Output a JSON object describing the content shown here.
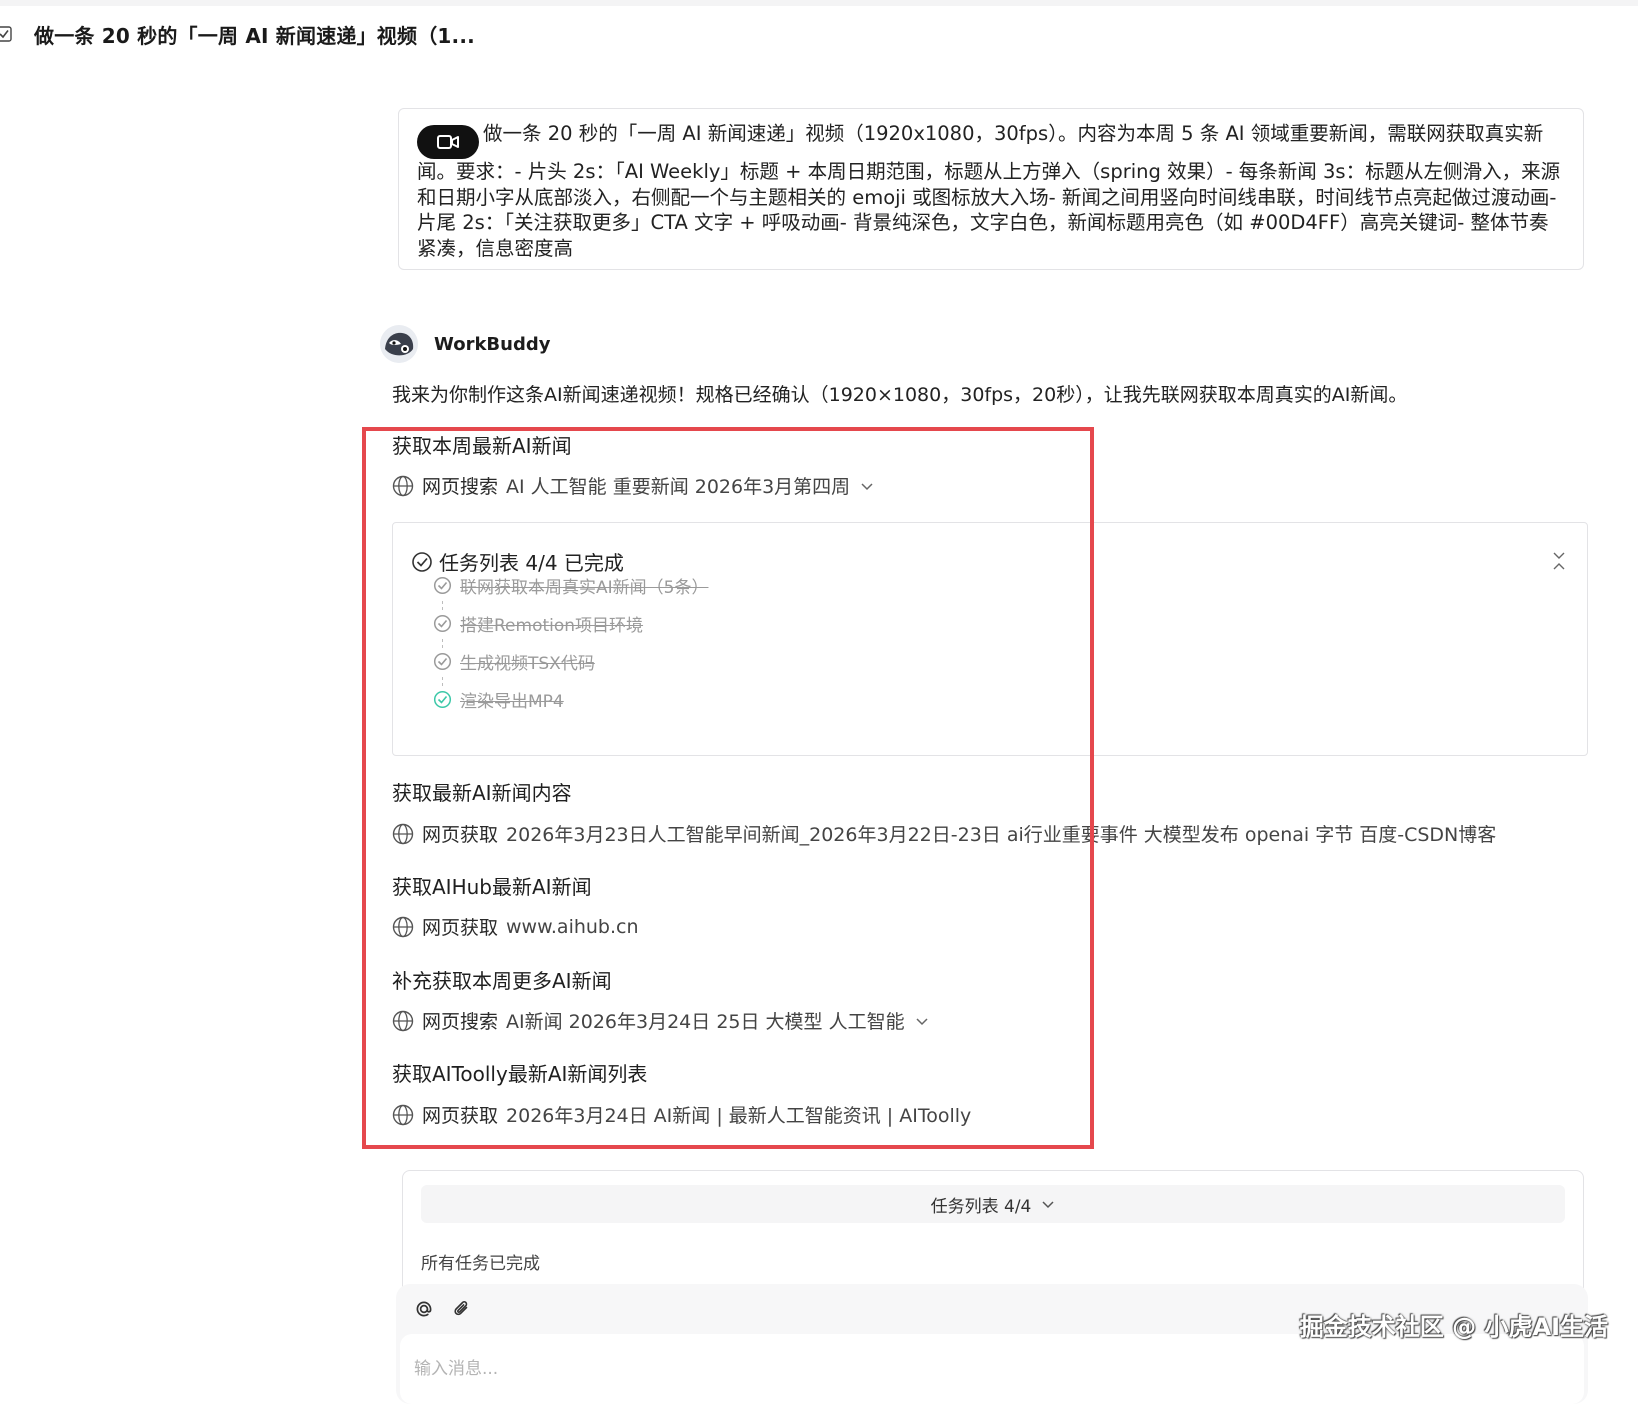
{
  "header": {
    "title": "做一条 20 秒的「一周 AI 新闻速递」视频（1..."
  },
  "prompt": {
    "text": "做一条 20 秒的「一周 AI 新闻速递」视频（1920x1080，30fps）。内容为本周 5 条 AI 领域重要新闻，需联网获取真实新闻。要求：- 片头 2s：「AI Weekly」标题 + 本周日期范围，标题从上方弹入（spring 效果）- 每条新闻 3s：标题从左侧滑入，来源和日期小字从底部淡入，右侧配一个与主题相关的 emoji 或图标放大入场- 新闻之间用竖向时间线串联，时间线节点亮起做过渡动画- 片尾 2s：「关注获取更多」CTA 文字 + 呼吸动画- 背景纯深色，文字白色，新闻标题用亮色（如 #00D4FF）高亮关键词- 整体节奏紧凑，信息密度高"
  },
  "assistant": {
    "name": "WorkBuddy",
    "intro": "我来为你制作这条AI新闻速递视频！规格已经确认（1920×1080，30fps，20秒），让我先联网获取本周真实的AI新闻。"
  },
  "steps": [
    {
      "title": "获取本周最新AI新闻",
      "verb": "网页搜索",
      "detail": "AI 人工智能 重要新闻 2026年3月第四周",
      "expandable": true
    },
    {
      "title": "获取最新AI新闻内容",
      "verb": "网页获取",
      "detail": "2026年3月23日人工智能早间新闻_2026年3月22日-23日 ai行业重要事件 大模型发布 openai 字节 百度-CSDN博客",
      "expandable": false
    },
    {
      "title": "获取AIHub最新AI新闻",
      "verb": "网页获取",
      "detail": "www.aihub.cn",
      "expandable": false
    },
    {
      "title": "补充获取本周更多AI新闻",
      "verb": "网页搜索",
      "detail": "AI新闻 2026年3月24日 25日 大模型 人工智能",
      "expandable": true
    },
    {
      "title": "获取AIToolly最新AI新闻列表",
      "verb": "网页获取",
      "detail": "2026年3月24日 AI新闻 | 最新人工智能资讯 | AIToolly",
      "expandable": false
    }
  ],
  "task_panel": {
    "header": "任务列表 4/4 已完成",
    "items": [
      {
        "label": "联网获取本周真实AI新闻（5条）",
        "done": true
      },
      {
        "label": "搭建Remotion项目环境",
        "done": true
      },
      {
        "label": "生成视频TSX代码",
        "done": true
      },
      {
        "label": "渲染导出MP4",
        "done": true
      }
    ]
  },
  "bottom": {
    "task_summary": "任务列表 4/4",
    "status": "所有任务已完成",
    "input_placeholder": "输入消息..."
  },
  "watermark": "掘金技术社区 @ 小虎AI生活",
  "colors": {
    "highlight": "#e5484d",
    "done_accent": "#3cc8a8",
    "done_muted": "#9a9a9a"
  }
}
